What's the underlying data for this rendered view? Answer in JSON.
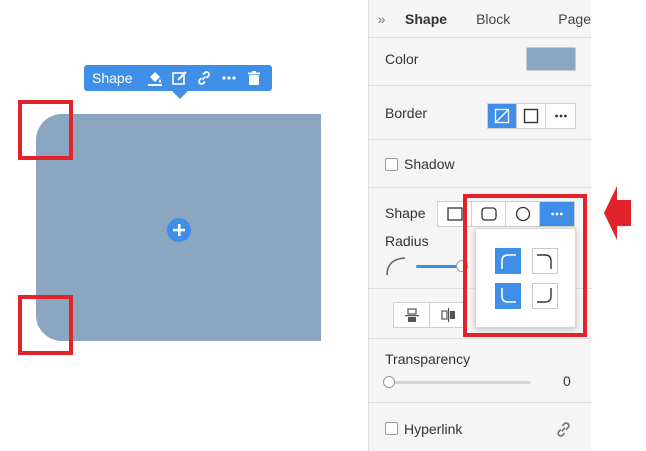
{
  "canvas": {
    "toolbar": {
      "label": "Shape"
    },
    "shape": {
      "fill": "#8aa6c1"
    }
  },
  "panel": {
    "tabs": [
      {
        "label": "Shape",
        "active": true
      },
      {
        "label": "Block",
        "active": false
      },
      {
        "label": "Page",
        "active": false
      }
    ],
    "color_label": "Color",
    "border_label": "Border",
    "shadow_label": "Shadow",
    "shape_label": "Shape",
    "radius_label": "Radius",
    "transparency_label": "Transparency",
    "transparency_value": "0",
    "hyperlink_label": "Hyperlink"
  },
  "colors": {
    "accent": "#3f8fe8",
    "shape_fill": "#8aa6c1",
    "highlight": "#e2232a"
  }
}
